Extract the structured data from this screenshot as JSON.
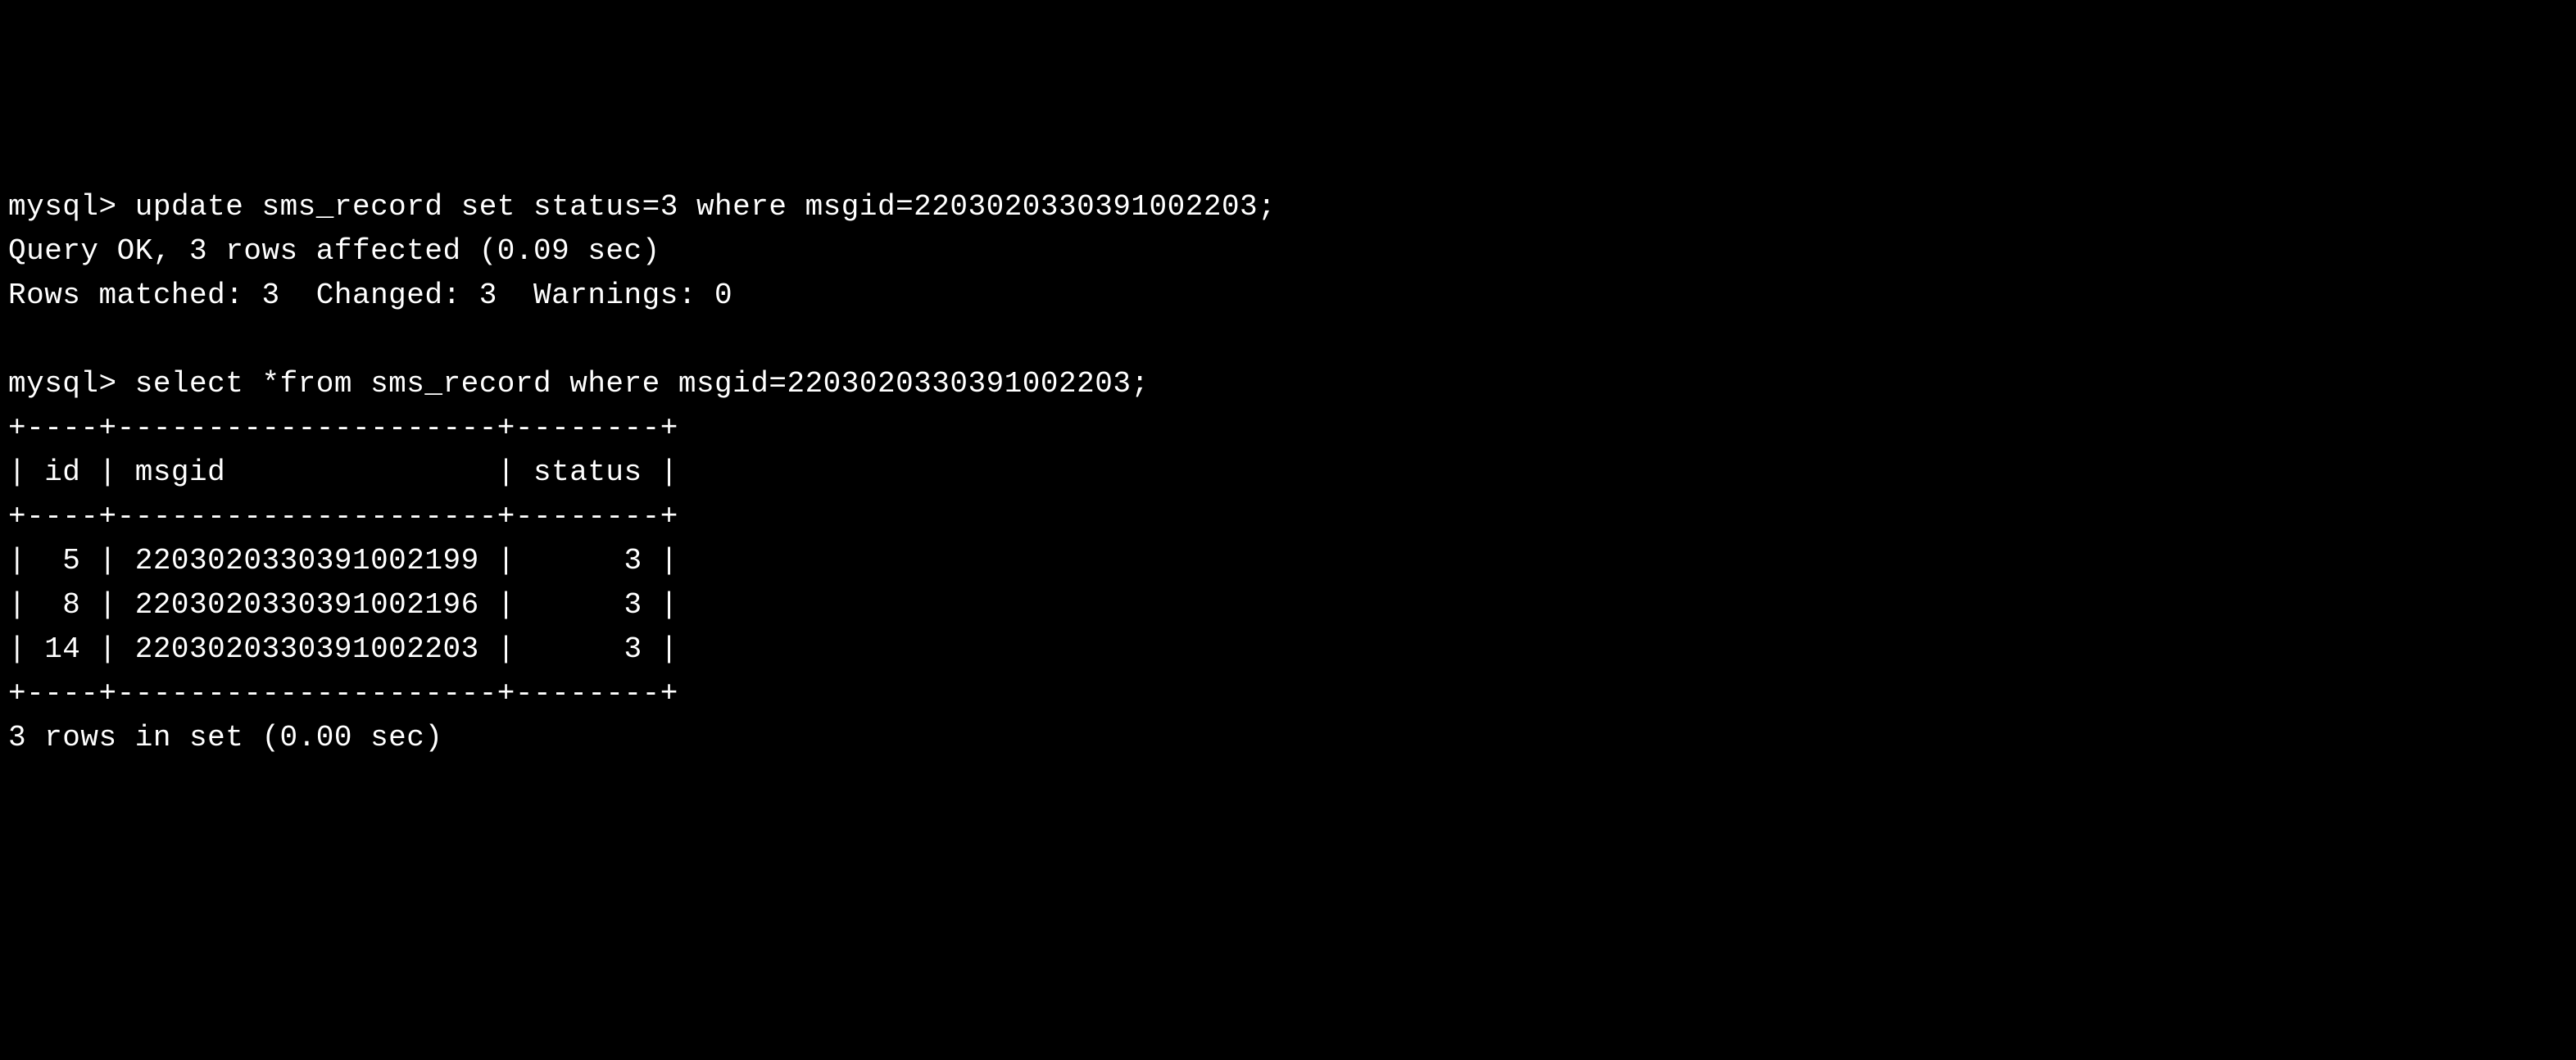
{
  "terminal": {
    "prompt": "mysql>",
    "command1": "update sms_record set status=3 where msgid=2203020330391002203;",
    "result1_line1": "Query OK, 3 rows affected (0.09 sec)",
    "result1_line2": "Rows matched: 3  Changed: 3  Warnings: 0",
    "command2": "select *from sms_record where msgid=2203020330391002203;",
    "table": {
      "border_top": "+----+---------------------+--------+",
      "header_row": "| id | msgid               | status |",
      "border_mid": "+----+---------------------+--------+",
      "row1": "|  5 | 2203020330391002199 |      3 |",
      "row2": "|  8 | 2203020330391002196 |      3 |",
      "row3": "| 14 | 2203020330391002203 |      3 |",
      "border_bottom": "+----+---------------------+--------+"
    },
    "result2": "3 rows in set (0.00 sec)"
  }
}
